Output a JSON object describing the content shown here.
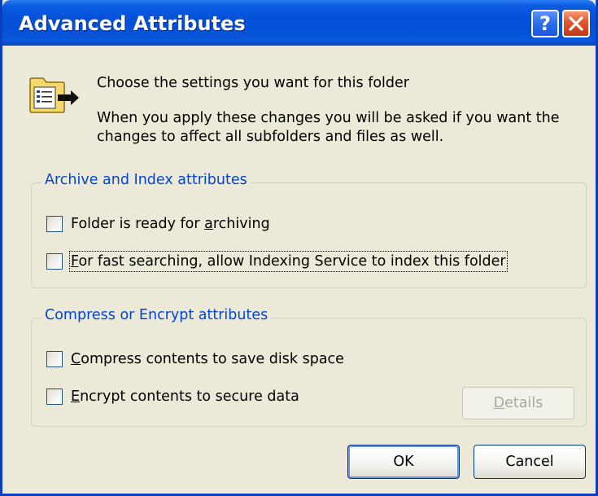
{
  "dialog": {
    "title": "Advanced Attributes",
    "help_glyph": "?",
    "help_icon": "question-mark-icon",
    "close_icon": "close-x-icon"
  },
  "intro": {
    "icon": "folder-attributes-icon",
    "heading": "Choose the settings you want for this folder",
    "description": "When you apply these changes you will be asked if you want the changes to affect all subfolders and files as well."
  },
  "archive_group": {
    "title": "Archive and Index attributes",
    "options": [
      {
        "pre": "Folder is ready for ",
        "key": "a",
        "post": "rchiving",
        "checked": false
      },
      {
        "pre": "",
        "key": "F",
        "post": "or fast searching, allow Indexing Service to index this folder",
        "checked": false,
        "focused": true
      }
    ]
  },
  "compress_group": {
    "title": "Compress or Encrypt attributes",
    "options": [
      {
        "pre": "",
        "key": "C",
        "post": "ompress contents to save disk space",
        "checked": false
      },
      {
        "pre": "",
        "key": "E",
        "post": "ncrypt contents to secure data",
        "checked": false
      }
    ],
    "details_button": {
      "key": "D",
      "post": "etails",
      "enabled": false
    }
  },
  "buttons": {
    "ok": "OK",
    "cancel": "Cancel"
  },
  "colors": {
    "title_bar": "#0054e3",
    "group_title": "#0046d5",
    "face": "#ece9d8",
    "close_button": "#e2552c"
  }
}
